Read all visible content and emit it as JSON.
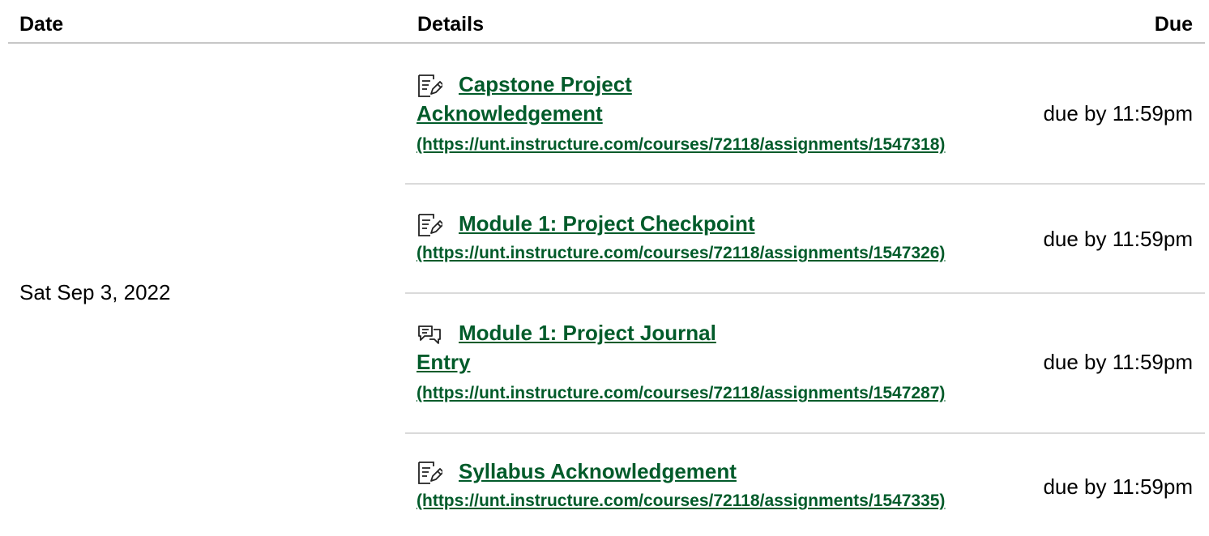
{
  "columns": {
    "date": "Date",
    "details": "Details",
    "due": "Due"
  },
  "date": "Sat Sep 3, 2022",
  "items": [
    {
      "icon": "assignment-icon",
      "title_line1": "Capstone Project",
      "title_line2": "Acknowledgement",
      "url": "(https://unt.instructure.com/courses/72118/assignments/1547318)",
      "due": "due by 11:59pm"
    },
    {
      "icon": "assignment-icon",
      "title_line1": "Module 1: Project Checkpoint",
      "url": "(https://unt.instructure.com/courses/72118/assignments/1547326)",
      "due": "due by 11:59pm"
    },
    {
      "icon": "discussion-icon",
      "title_line1": "Module 1: Project Journal",
      "title_line2": "Entry",
      "url": "(https://unt.instructure.com/courses/72118/assignments/1547287)",
      "due": "due by 11:59pm"
    },
    {
      "icon": "assignment-icon",
      "title_line1": "Syllabus Acknowledgement",
      "url": "(https://unt.instructure.com/courses/72118/assignments/1547335)",
      "due": "due by 11:59pm"
    }
  ],
  "colors": {
    "link": "#015b2a",
    "divider": "#dadada",
    "header_rule": "#c7c7c7"
  }
}
